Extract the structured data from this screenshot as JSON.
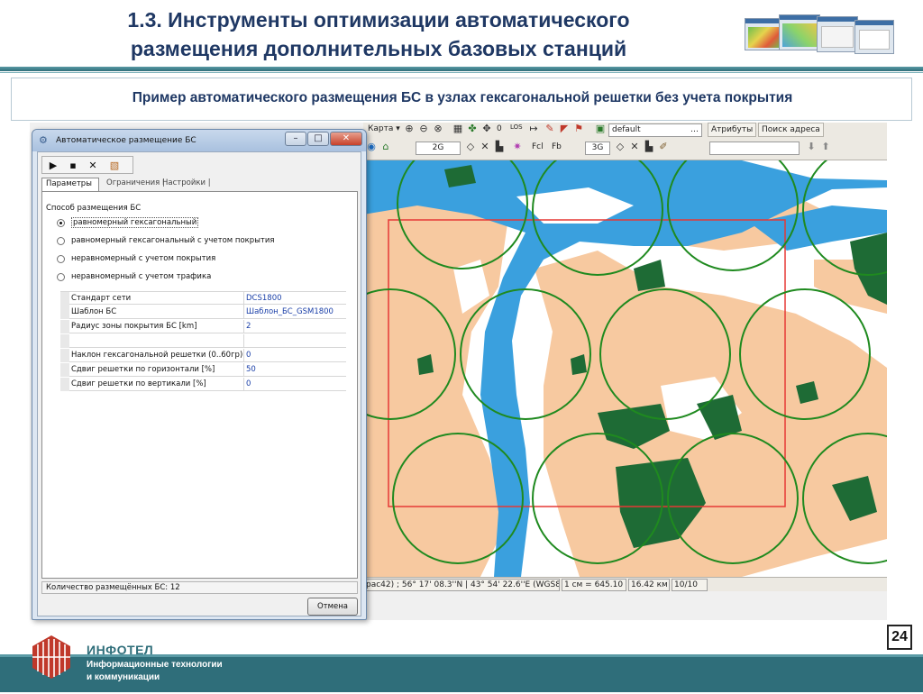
{
  "slide": {
    "title_line1": "1.3. Инструменты оптимизации автоматического",
    "title_line2": "размещения дополнительных базовых станций",
    "subtitle": "Пример автоматического размещения БС в узлах гексагональной решетки без учета покрытия",
    "page_number": "24"
  },
  "colors": {
    "title": "#1f3864",
    "accent_teal": "#2f6e7a",
    "logo_red": "#c0392b",
    "map_river": "#3aa0de",
    "map_urban": "#f7c9a0",
    "map_forest": "#1e6b35",
    "coverage_circle": "#1f8a1f",
    "area_rect": "#e53935"
  },
  "dialog": {
    "title": "Автоматическое размещение БС",
    "toolbar": [
      "play-icon",
      "save-icon",
      "close-icon",
      "layers-icon"
    ],
    "tabs": {
      "params": "Параметры",
      "limits": "Ограничения |",
      "settings": "Настройки |"
    },
    "method_label": "Способ размещения БС",
    "methods": [
      {
        "label": "равномерный гексагональный",
        "checked": true
      },
      {
        "label": "равномерный гексагональный с учетом покрытия",
        "checked": false
      },
      {
        "label": "неравномерный с учетом покрытия",
        "checked": false
      },
      {
        "label": "неравномерный с учетом трафика",
        "checked": false
      }
    ],
    "properties": [
      {
        "name": "Стандарт сети",
        "value": "DCS1800"
      },
      {
        "name": "Шаблон БС",
        "value": "Шаблон_БС_GSM1800"
      },
      {
        "name": "Радиус зоны покрытия БС [km]",
        "value": "2"
      },
      {
        "name": "",
        "value": ""
      },
      {
        "name": "Наклон гексагональной решетки (0..60гр)",
        "value": "0"
      },
      {
        "name": "Сдвиг решетки по горизонтали [%]",
        "value": "50"
      },
      {
        "name": "Сдвиг решетки по вертикали [%]",
        "value": "0"
      }
    ],
    "count_label": "Количество размещённых БС: 12",
    "cancel_label": "Отмена"
  },
  "map_toolbar": {
    "map_menu": "Карта ▾",
    "los": "LOS",
    "layer_select": "default",
    "attributes": "Атрибуты",
    "address_search": "Поиск адреса",
    "tech_2g": "2G",
    "tech_3g": "3G",
    "f_cl": "Fcl",
    "f_b": "Fb",
    "zero": "0"
  },
  "map_status": {
    "coords": "рас42) ; 56° 17' 08.3''N  |  43° 54' 22.6''E (WGS84)",
    "scale": "1 см = 645.10 м",
    "distance": "16.42 км",
    "zoom": "10/10"
  },
  "footer": {
    "brand": "ИНФОТЕЛ",
    "tagline1": "Информационные технологии",
    "tagline2": "и коммуникации"
  }
}
